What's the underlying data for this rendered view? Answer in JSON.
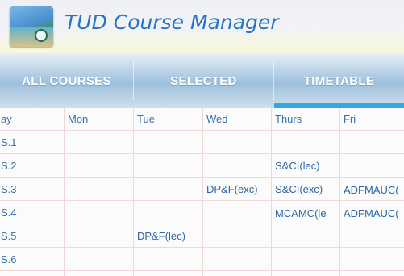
{
  "app": {
    "title": "TUD Course Manager",
    "icon": "app-logo-icon"
  },
  "tabs": [
    {
      "label": "ALL COURSES",
      "selected": false
    },
    {
      "label": "SELECTED",
      "selected": false
    },
    {
      "label": "TIMETABLE",
      "selected": true
    }
  ],
  "colors": {
    "title": "#2874c4",
    "tab_indicator": "#34a6e0",
    "cell_text": "#2f66a8",
    "grid_line": "#f1d8d8"
  },
  "timetable": {
    "headers": [
      "ay",
      "Mon",
      "Tue",
      "Wed",
      "Thurs",
      "Fri"
    ],
    "rows": [
      [
        "S.1",
        "",
        "",
        "",
        "",
        ""
      ],
      [
        "S.2",
        "",
        "",
        "",
        "S&CI(lec)",
        ""
      ],
      [
        "S.3",
        "",
        "",
        "DP&F(exc)",
        "S&CI(exc)",
        "ADFMAUC("
      ],
      [
        "S.4",
        "",
        "",
        "",
        "MCAMC(le",
        "ADFMAUC("
      ],
      [
        "S.5",
        "",
        "DP&F(lec)",
        "",
        "",
        ""
      ],
      [
        "S.6",
        "",
        "",
        "",
        "",
        ""
      ]
    ]
  }
}
